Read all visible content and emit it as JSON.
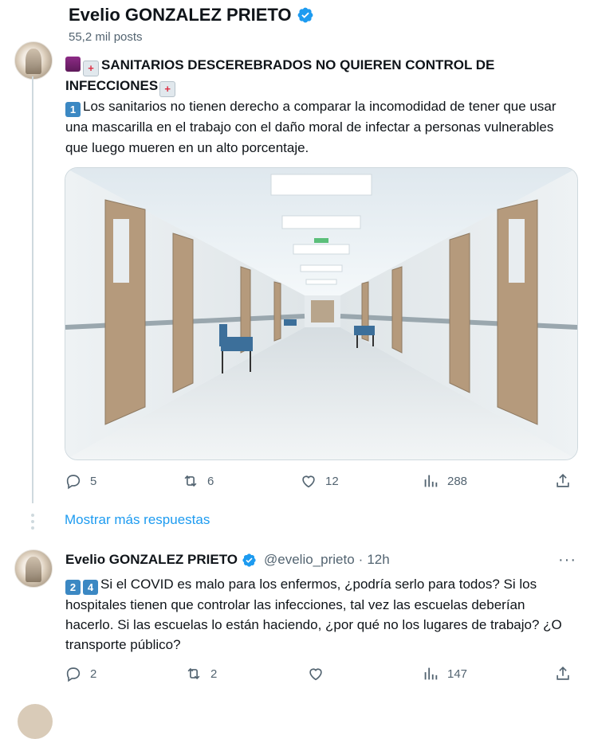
{
  "header": {
    "name": "Evelio GONZALEZ PRIETO",
    "posts_count": "55,2 mil posts"
  },
  "tweet": {
    "title_icon_1": "thread-icon",
    "title_icon_2": "hospital-icon",
    "title": "SANITARIOS DESCEREBRADOS NO QUIEREN CONTROL DE INFECCIONES",
    "title_icon_end": "hospital-icon",
    "number_badge": "1",
    "body": "Los sanitarios no tienen derecho a comparar la incomodidad de tener que usar una mascarilla en el trabajo con el daño moral de infectar a personas vulnerables que luego mueren en un alto porcentaje.",
    "image_alt": "hospital-corridor-photo",
    "actions": {
      "replies": "5",
      "reposts": "6",
      "likes": "12",
      "views": "288"
    }
  },
  "show_more": "Mostrar más respuestas",
  "reply": {
    "name": "Evelio GONZALEZ PRIETO",
    "handle": "@evelio_prieto",
    "separator": "·",
    "time": "12h",
    "more": "···",
    "badges": [
      "2",
      "4"
    ],
    "body": "Si el COVID es malo para los enfermos, ¿podría serlo para todos? Si los hospitales tienen que  controlar las infecciones, tal vez las escuelas deberían hacerlo. Si las escuelas lo están haciendo, ¿por qué no los lugares de trabajo? ¿O transporte público?",
    "actions": {
      "replies": "2",
      "reposts": "2",
      "likes": "",
      "views": "147"
    }
  },
  "colors": {
    "accent": "#1d9bf0",
    "text": "#0f1419",
    "muted": "#536471",
    "verified": "#1d9bf0"
  }
}
